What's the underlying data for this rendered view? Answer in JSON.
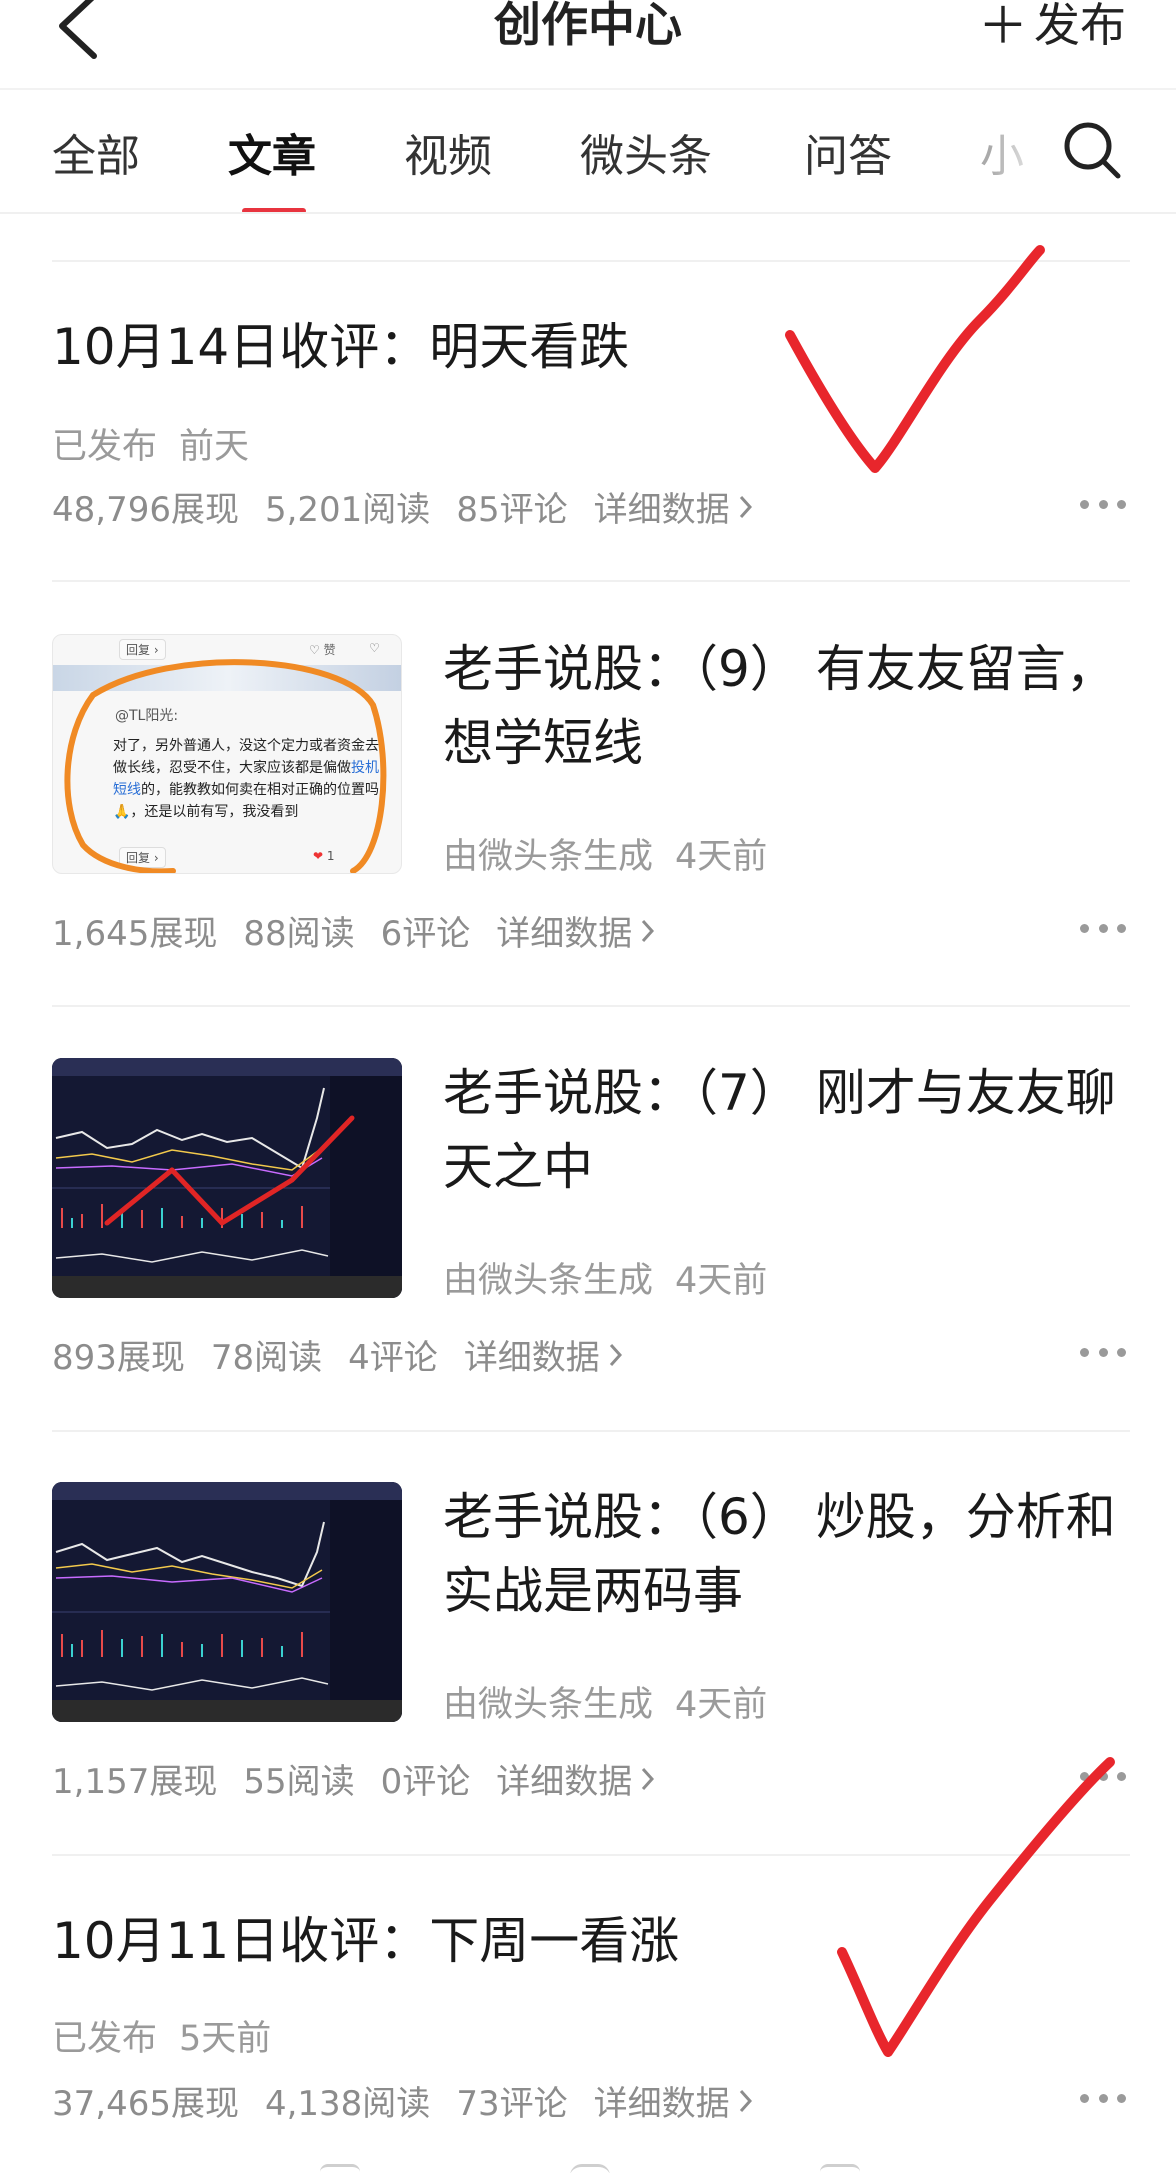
{
  "header": {
    "title": "创作中心",
    "publish_label": "发布"
  },
  "tabs": [
    {
      "label": "全部"
    },
    {
      "label": "文章"
    },
    {
      "label": "视频"
    },
    {
      "label": "微头条"
    },
    {
      "label": "问答"
    },
    {
      "label": "小"
    }
  ],
  "articles": [
    {
      "title": "10月14日收评：明天看跌",
      "status": "已发布",
      "time": "前天",
      "impressions": "48,796展现",
      "reads": "5,201阅读",
      "comments": "85评论",
      "detail": "详细数据"
    },
    {
      "title": "老手说股：（9） 有友友留言，想学短线",
      "source": "由微头条生成",
      "time": "4天前",
      "impressions": "1,645展现",
      "reads": "88阅读",
      "comments": "6评论",
      "detail": "详细数据",
      "thumb": {
        "reply": "回复",
        "like": "赞",
        "user": "@TL阳光:",
        "text_before": "对了，另外普通人，没这个定力或者资金去做长线，忍受不住，大家应该都是偏做",
        "link": "投机短线",
        "text_after": "的，能教教如何卖在相对正确的位置吗🙏，还是以前有写，我没看到",
        "like_count": "1"
      }
    },
    {
      "title": "老手说股：（7） 刚才与友友聊天之中",
      "source": "由微头条生成",
      "time": "4天前",
      "impressions": "893展现",
      "reads": "78阅读",
      "comments": "4评论",
      "detail": "详细数据"
    },
    {
      "title": "老手说股：（6） 炒股，分析和实战是两码事",
      "source": "由微头条生成",
      "time": "4天前",
      "impressions": "1,157展现",
      "reads": "55阅读",
      "comments": "0评论",
      "detail": "详细数据"
    },
    {
      "title": "10月11日收评：下周一看涨",
      "status": "已发布",
      "time": "5天前",
      "impressions": "37,465展现",
      "reads": "4,138阅读",
      "comments": "73评论",
      "detail": "详细数据"
    }
  ],
  "colors": {
    "accent": "#e8343f",
    "checkmark": "#e8262c",
    "muted": "#9a9a9a"
  }
}
